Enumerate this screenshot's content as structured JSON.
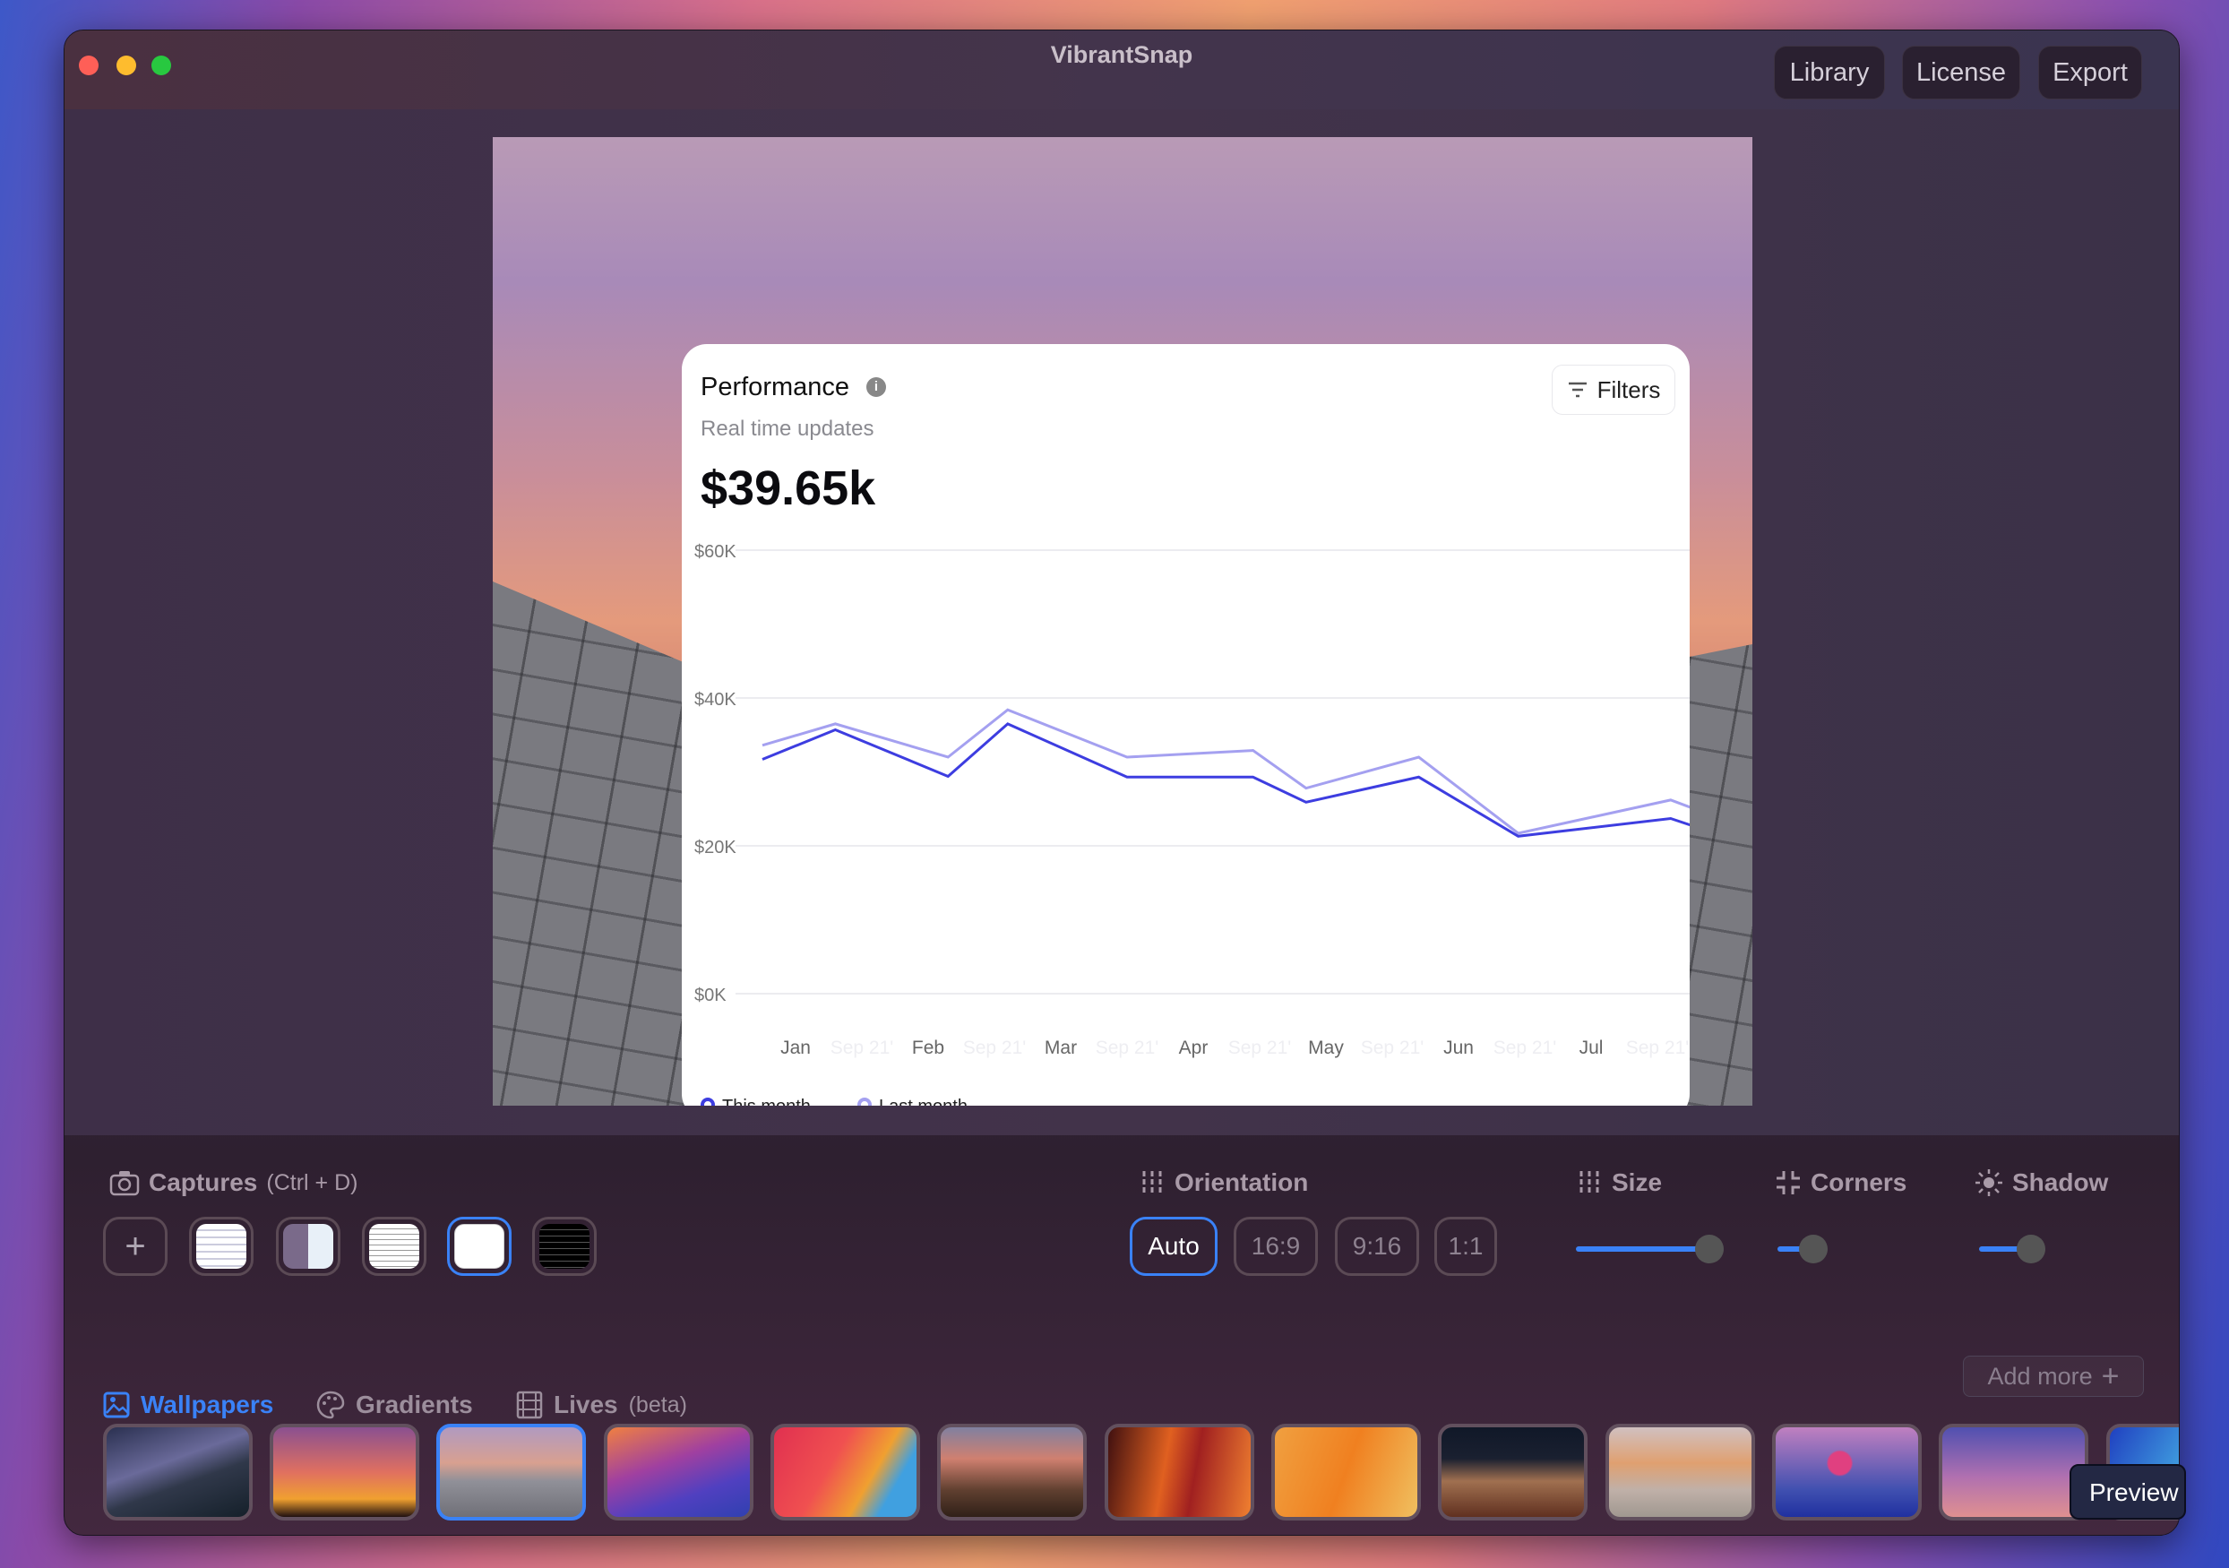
{
  "window": {
    "title": "VibrantSnap",
    "buttons": [
      "Library",
      "License",
      "Export"
    ]
  },
  "card": {
    "title": "Performance",
    "info_icon": "info-icon",
    "subtitle": "Real time updates",
    "value": "$39.65k",
    "filters_label": "Filters"
  },
  "chart_data": {
    "type": "line",
    "categories": [
      "Jan",
      "Sep 21'",
      "Feb",
      "Sep 21'",
      "Mar",
      "Sep 21'",
      "Apr",
      "Sep 21'",
      "May",
      "Sep 21'",
      "Jun",
      "Sep 21'",
      "Jul",
      "Sep 21'"
    ],
    "y_ticks": [
      "$0K",
      "$20K",
      "$40K",
      "$60K"
    ],
    "ylim": [
      0,
      60000
    ],
    "grid": true,
    "legend_position": "bottom-left",
    "series": [
      {
        "name": "This month",
        "color": "#3d3de0",
        "x": [
          -0.5,
          0.6,
          2.3,
          3.2,
          5.0,
          6.9,
          7.7,
          9.4,
          10.9,
          13.2,
          13.5
        ],
        "values": [
          31700,
          35700,
          29400,
          36500,
          29300,
          29300,
          25900,
          29300,
          21300,
          23700,
          22800
        ]
      },
      {
        "name": "Last month",
        "color": "#a4a0f0",
        "x": [
          -0.5,
          0.6,
          2.3,
          3.2,
          5.0,
          6.9,
          7.7,
          9.4,
          10.9,
          13.2,
          13.5
        ],
        "values": [
          33600,
          36500,
          32000,
          38400,
          32000,
          32900,
          27800,
          32000,
          21700,
          26200,
          25200
        ]
      }
    ]
  },
  "captures": {
    "label": "Captures",
    "shortcut": "(Ctrl + D)",
    "add_label": "+",
    "selected_index": 3
  },
  "orientation": {
    "label": "Orientation",
    "options": [
      "Auto",
      "16:9",
      "9:16",
      "1:1"
    ],
    "selected": "Auto"
  },
  "size": {
    "label": "Size",
    "value_pct": 90
  },
  "corners": {
    "label": "Corners",
    "value_pct": 24
  },
  "shadow": {
    "label": "Shadow",
    "value_pct": 35
  },
  "tabs": {
    "items": [
      "Wallpapers",
      "Gradients",
      "Lives"
    ],
    "lives_suffix": "(beta)",
    "active": "Wallpapers"
  },
  "add_more": {
    "label": "Add more",
    "icon": "+"
  },
  "tooltip": "Preview",
  "accent": "#3a82f7"
}
